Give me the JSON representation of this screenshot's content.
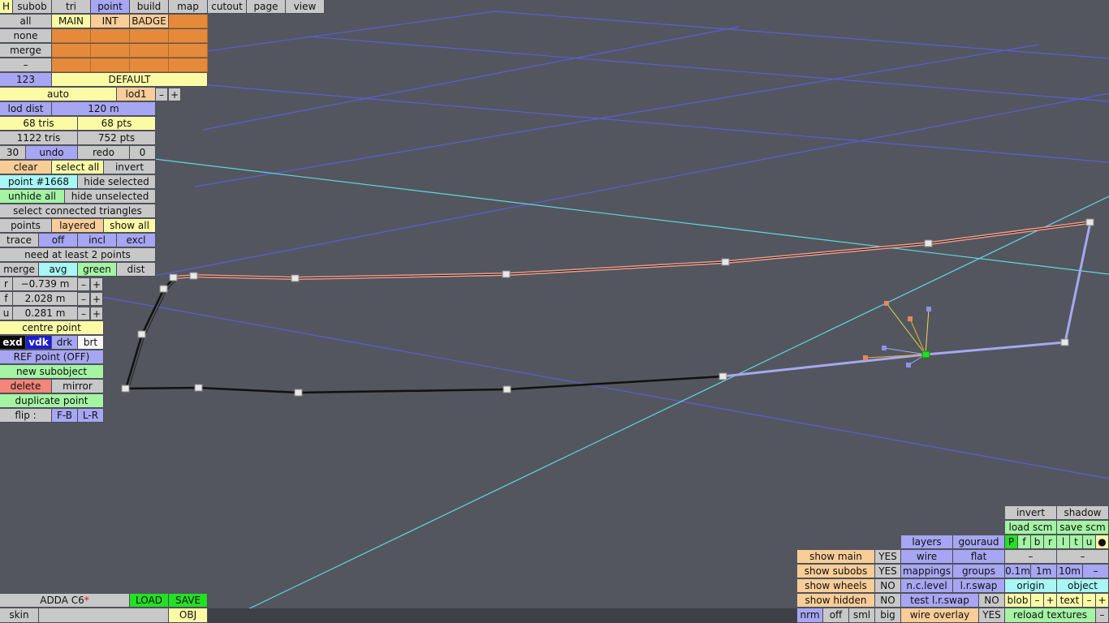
{
  "menu": {
    "h": "H",
    "subob": "subob",
    "tri": "tri",
    "point": "point",
    "build": "build",
    "map": "map",
    "cutout": "cutout",
    "page": "page",
    "view": "view"
  },
  "layers": {
    "all": "all",
    "main": "MAIN",
    "int": "INT",
    "badge": "BADGE",
    "none": "none",
    "merge": "merge",
    "dash": "–",
    "num": "123",
    "default": "DEFAULT"
  },
  "lod": {
    "auto": "auto",
    "lod1": "lod1",
    "minus": "–",
    "plus": "+",
    "dist_label": "lod dist",
    "dist_value": "120 m"
  },
  "stats": {
    "tris_sel": "68 tris",
    "pts_sel": "68 pts",
    "tris_total": "1122 tris",
    "pts_total": "752 pts"
  },
  "history": {
    "undo_count": "30",
    "undo": "undo",
    "redo": "redo",
    "redo_count": "0"
  },
  "select": {
    "clear": "clear",
    "select_all": "select all",
    "invert": "invert",
    "point": "point #1668",
    "hide_selected": "hide selected",
    "unhide_all": "unhide all",
    "hide_unselected": "hide unselected",
    "select_connected": "select connected triangles"
  },
  "mode": {
    "points": "points",
    "layered": "layered",
    "show_all": "show all",
    "trace": "trace",
    "off": "off",
    "incl": "incl",
    "excl": "excl",
    "need": "need at least 2 points"
  },
  "merge": {
    "merge": "merge",
    "avg": "avg",
    "green": "green",
    "dist": "dist"
  },
  "coords": {
    "r_label": "r",
    "r_value": "−0.739 m",
    "f_label": "f",
    "f_value": "2.028 m",
    "u_label": "u",
    "u_value": "0.281 m",
    "minus": "–",
    "plus": "+"
  },
  "tools": {
    "centre": "centre point",
    "exd": "exd",
    "vdk": "vdk",
    "drk": "drk",
    "brt": "brt",
    "ref": "REF point (OFF)",
    "new_subobject": "new subobject",
    "delete": "delete",
    "mirror": "mirror",
    "duplicate": "duplicate point",
    "flip": "flip :",
    "fb": "F-B",
    "lr": "L-R"
  },
  "file": {
    "name": "ADDA C6",
    "modified": "*",
    "load": "LOAD",
    "save": "SAVE",
    "skin": "skin",
    "obj": "OBJ"
  },
  "view": {
    "invert": "invert",
    "shadow": "shadow",
    "load_scm": "load scm",
    "save_scm": "save scm",
    "layers": "layers",
    "gouraud": "gouraud",
    "pfbrltu": [
      "P",
      "f",
      "b",
      "r",
      "l",
      "t",
      "u"
    ],
    "dot": "●",
    "show_main": "show main",
    "show_main_v": "YES",
    "wire": "wire",
    "flat": "flat",
    "dash": "–",
    "show_subobs": "show subobs",
    "show_subobs_v": "YES",
    "mappings": "mappings",
    "groups": "groups",
    "m01": "0.1m",
    "m1": "1m",
    "m10": "10m",
    "show_wheels": "show wheels",
    "show_wheels_v": "NO",
    "nclevel": "n.c.level",
    "lrswap": "l.r.swap",
    "origin": "origin",
    "object": "object",
    "show_hidden": "show hidden",
    "show_hidden_v": "NO",
    "test_lrswap": "test l.r.swap",
    "test_lrswap_v": "NO",
    "blob": "blob",
    "text": "text",
    "plus": "+",
    "nrm": "nrm",
    "off": "off",
    "sml": "sml",
    "big": "big",
    "wire_overlay": "wire overlay",
    "wire_overlay_v": "YES",
    "reload": "reload textures"
  }
}
